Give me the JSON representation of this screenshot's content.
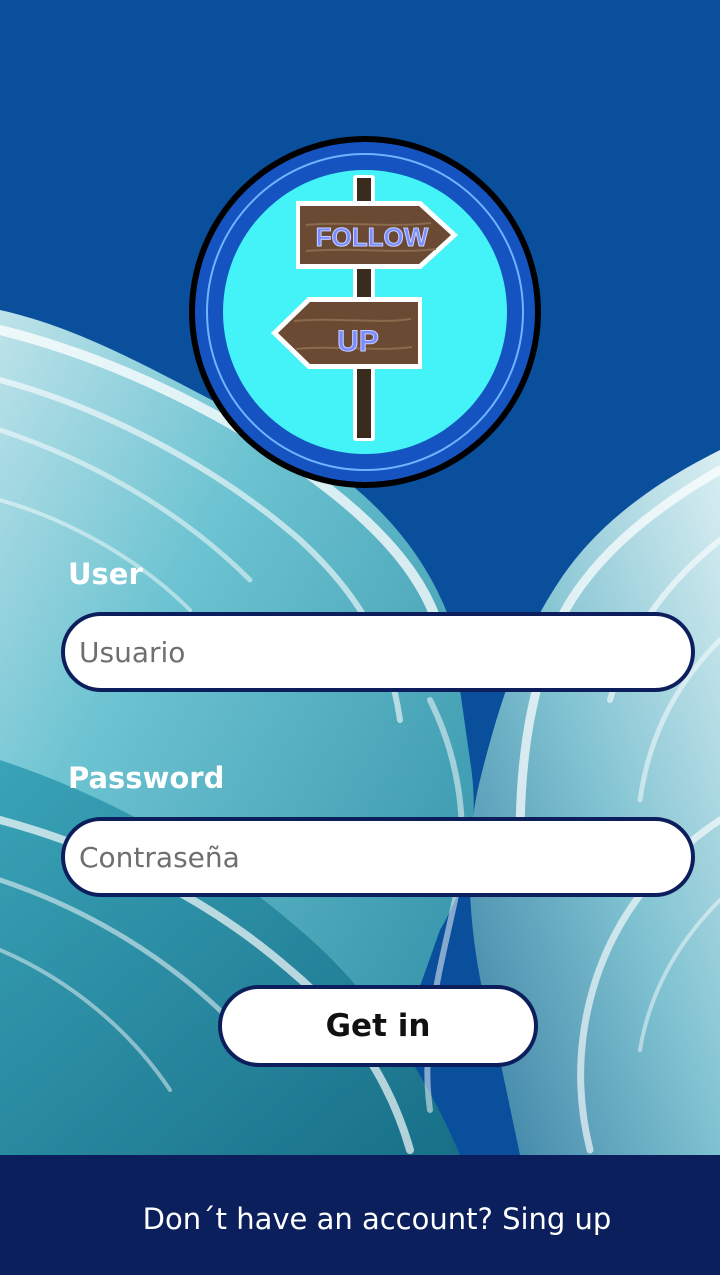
{
  "logo": {
    "top_sign_text": "FOLLOW",
    "bottom_sign_text": "UP"
  },
  "login_form": {
    "user_label": "User",
    "user_placeholder": "Usuario",
    "password_label": "Password",
    "password_placeholder": "Contraseña",
    "submit_label": "Get in"
  },
  "footer": {
    "signup_link": "Don´t have an account? Sing up"
  },
  "colors": {
    "background_top": "#0a4f9c",
    "wave_teal": "#5ab8c8",
    "wave_dark": "#1e7d95",
    "border_navy": "#0c1f5c",
    "footer": "#0b1f5d",
    "logo_inner": "#44f3f7",
    "logo_ring": "#1553c0",
    "sign_wood": "#6a4a32"
  },
  "icons": {
    "logo": "signpost-logo-icon"
  }
}
